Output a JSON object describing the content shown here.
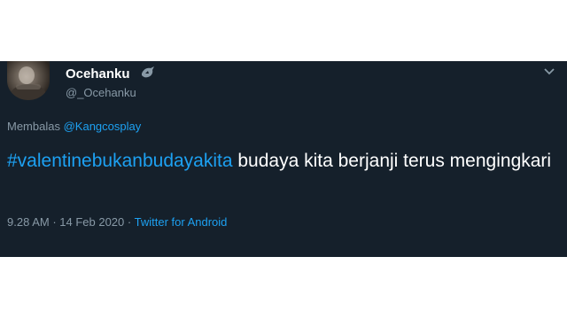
{
  "tweet": {
    "author": {
      "display_name": "Ocehanku",
      "handle": "@_Ocehanku",
      "badge_icon": "bird-icon",
      "avatar": "profile-photo"
    },
    "reply": {
      "prefix": "Membalas",
      "mention": "@Kangcosplay"
    },
    "text": {
      "hashtag": "#valentinebukanbudayakita",
      "body": " budaya kita berjanji terus mengingkari"
    },
    "meta": {
      "time": "9.28 AM",
      "separator": " · ",
      "date": "14 Feb 2020",
      "source": "Twitter for Android"
    }
  },
  "colors": {
    "background": "#15202b",
    "primary_text": "#ffffff",
    "secondary_text": "#8899a6",
    "link": "#1da1f2"
  }
}
